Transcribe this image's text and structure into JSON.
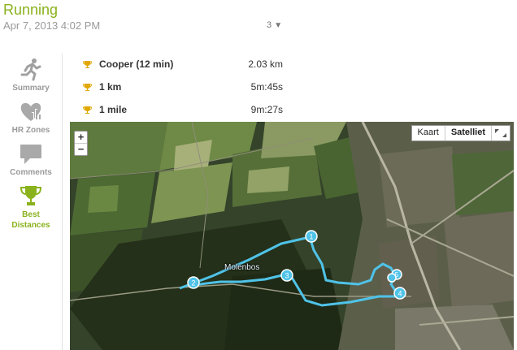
{
  "activity": {
    "title": "Running",
    "date": "Apr 7, 2013 4:02 PM",
    "trophy_count": "3"
  },
  "sidebar": {
    "items": [
      {
        "label": "Summary",
        "icon": "runner-icon",
        "active": false
      },
      {
        "label": "HR Zones",
        "icon": "heart-chart-icon",
        "active": false
      },
      {
        "label": "Comments",
        "icon": "speech-bubble-icon",
        "active": false
      },
      {
        "label": "Best Distances",
        "icon": "trophy-icon",
        "active": true
      }
    ]
  },
  "records": [
    {
      "name": "Cooper (12 min)",
      "value": "2.03 km"
    },
    {
      "name": "1 km",
      "value": "5m:45s"
    },
    {
      "name": "1 mile",
      "value": "9m:27s"
    }
  ],
  "map": {
    "zoom_in": "+",
    "zoom_out": "−",
    "type_map": "Kaart",
    "type_satellite": "Satelliet",
    "selected_type": "Satelliet",
    "place_label": "Molenbos",
    "route_color": "#4fc3e8",
    "markers": [
      "1",
      "2",
      "3",
      "4",
      "5"
    ]
  },
  "colors": {
    "accent": "#8ab21c",
    "muted": "#9a9a9a"
  }
}
